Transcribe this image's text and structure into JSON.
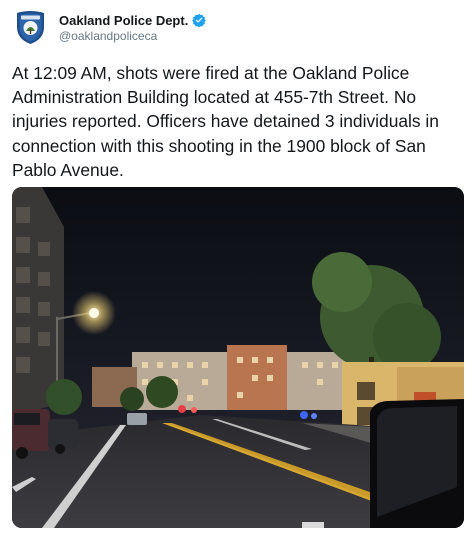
{
  "tweet": {
    "author": {
      "display_name": "Oakland Police Dept.",
      "handle": "@oaklandpoliceca",
      "avatar_icon": "police-badge-icon",
      "verified_icon": "verified-badge-icon",
      "verified_color": "#1da1f2"
    },
    "text": "At 12:09 AM, shots were fired at the Oakland Police Administration Building located at 455-7th Street. No injuries reported. Officers have detained 3 individuals in connection with this shooting in the 1900 block of San Pablo Avenue.",
    "media": {
      "type": "photo",
      "scene": "night-street-photo"
    }
  },
  "colors": {
    "text_primary": "#14171a",
    "text_secondary": "#657786",
    "badge_blue": "#1f4e8c"
  }
}
